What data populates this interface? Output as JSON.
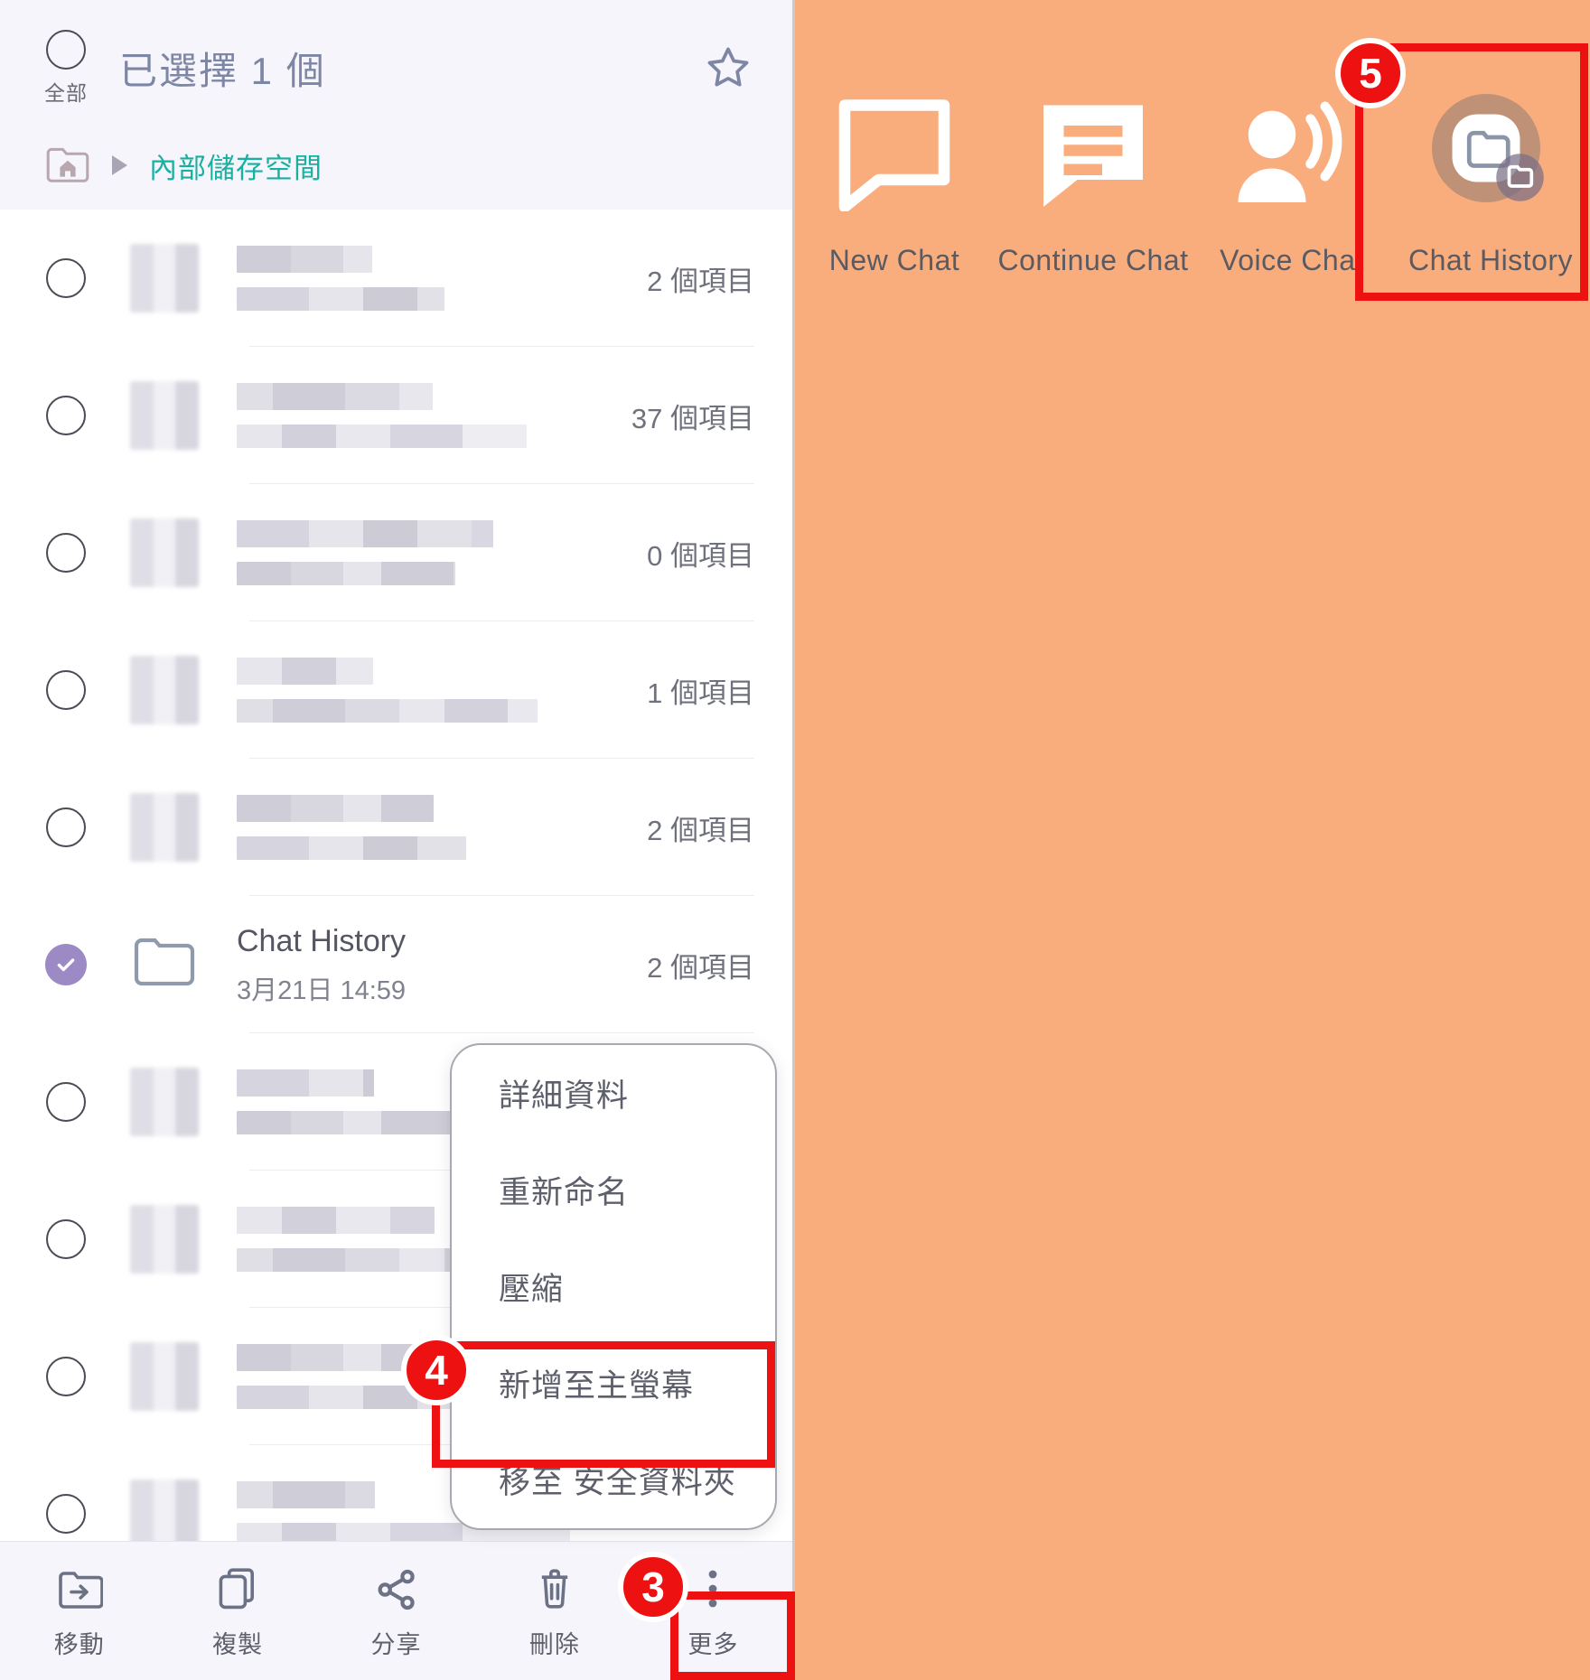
{
  "file_manager": {
    "select_all_label": "全部",
    "selection_title": "已選擇 1 個",
    "star_icon": "star-outline-icon",
    "breadcrumb": {
      "home_icon": "folder-home-icon",
      "separator_icon": "triangle-right-icon",
      "path": "內部儲存空間"
    },
    "rows": [
      {
        "name": "",
        "sub": "",
        "count": "2 個項目",
        "selected": false,
        "blurred": true,
        "icon": "folder-icon"
      },
      {
        "name": "",
        "sub": "",
        "count": "37 個項目",
        "selected": false,
        "blurred": true,
        "icon": "folder-icon"
      },
      {
        "name": "",
        "sub": "",
        "count": "0 個項目",
        "selected": false,
        "blurred": true,
        "icon": "folder-icon"
      },
      {
        "name": "",
        "sub": "",
        "count": "1 個項目",
        "selected": false,
        "blurred": true,
        "icon": "folder-icon"
      },
      {
        "name": "",
        "sub": "",
        "count": "2 個項目",
        "selected": false,
        "blurred": true,
        "icon": "folder-icon"
      },
      {
        "name": "Chat History",
        "sub": "3月21日 14:59",
        "count": "2 個項目",
        "selected": true,
        "blurred": false,
        "icon": "folder-icon"
      },
      {
        "name": "",
        "sub": "",
        "count": "",
        "selected": false,
        "blurred": true,
        "icon": "folder-icon"
      },
      {
        "name": "",
        "sub": "",
        "count": "",
        "selected": false,
        "blurred": true,
        "icon": "folder-icon"
      },
      {
        "name": "",
        "sub": "",
        "count": "",
        "selected": false,
        "blurred": true,
        "icon": "folder-icon"
      },
      {
        "name": "",
        "sub": "",
        "count": "",
        "selected": false,
        "blurred": true,
        "icon": "folder-icon"
      }
    ],
    "context_menu": {
      "items": [
        {
          "label": "詳細資料"
        },
        {
          "label": "重新命名"
        },
        {
          "label": "壓縮"
        },
        {
          "label": "新增至主螢幕"
        },
        {
          "label": "移至 安全資料夾"
        }
      ]
    },
    "bottom_bar": {
      "items": [
        {
          "label": "移動",
          "icon": "move-to-folder-icon"
        },
        {
          "label": "複製",
          "icon": "copy-icon"
        },
        {
          "label": "分享",
          "icon": "share-icon"
        },
        {
          "label": "刪除",
          "icon": "trash-icon"
        },
        {
          "label": "更多",
          "icon": "more-vertical-icon"
        }
      ]
    }
  },
  "home_screen": {
    "background_color": "#f9ad7c",
    "shortcuts": [
      {
        "label": "New Chat",
        "icon": "speech-bubble-outline-icon"
      },
      {
        "label": "Continue Chat",
        "icon": "speech-bubble-lines-icon"
      },
      {
        "label": "Voice Chat",
        "icon": "person-speaking-icon"
      },
      {
        "label": "Chat History",
        "icon": "folder-shortcut-app-icon"
      }
    ]
  },
  "annotations": {
    "accent_color": "#ee1111",
    "badges": [
      {
        "number": "3",
        "target": "更多"
      },
      {
        "number": "4",
        "target": "新增至主螢幕"
      },
      {
        "number": "5",
        "target": "Chat History"
      }
    ]
  }
}
